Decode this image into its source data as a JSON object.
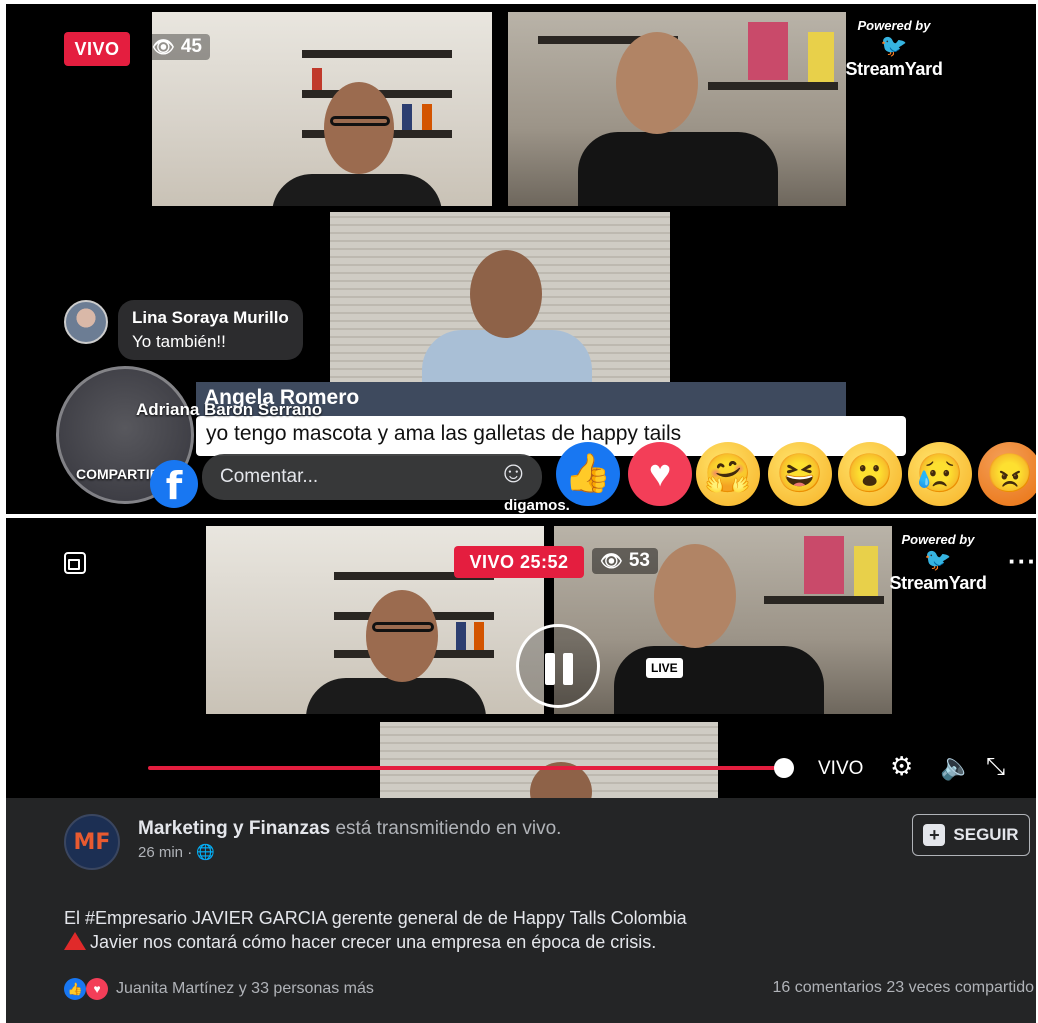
{
  "top": {
    "live_label": "VIVO",
    "viewer_count": "45",
    "streamyard_powered": "Powered by",
    "streamyard_name": "StreamYard",
    "comment1": {
      "name": "Lina Soraya Murillo",
      "text": "Yo también!!"
    },
    "banner": {
      "name": "Angela Romero",
      "text": "yo tengo mascota y ama las galletas de happy tails"
    },
    "share_name": "Adriana Baron Serrano",
    "share_label": "COMPARTIR",
    "fb_logo": "f",
    "comment_placeholder": "Comentar...",
    "caption_fragment": "digamos.",
    "reactions": [
      "like",
      "love",
      "care",
      "haha",
      "wow",
      "sad",
      "angry"
    ]
  },
  "bottom": {
    "live_label": "VIVO 25:52",
    "viewer_count": "53",
    "streamyard_powered": "Powered by",
    "streamyard_name": "StreamYard",
    "live_chip": "LIVE",
    "vivo_control": "VIVO",
    "post": {
      "page_name": "Marketing y Finanzas",
      "status": "está transmitiendo en vivo.",
      "time": "26 min ·",
      "follow_label": "SEGUIR",
      "line1": "El #Empresario JAVIER GARCIA  gerente general de de Happy Talls Colombia",
      "line2": "Javier nos contará cómo hacer crecer una empresa en época de crisis.",
      "reactors": "Juanita Martínez y 33 personas más",
      "comments": "16 comentarios",
      "shares": "23 veces compartido"
    }
  },
  "colors": {
    "live_red": "#e41e3f",
    "fb_blue": "#1877f2",
    "dark_bg": "#242526"
  }
}
